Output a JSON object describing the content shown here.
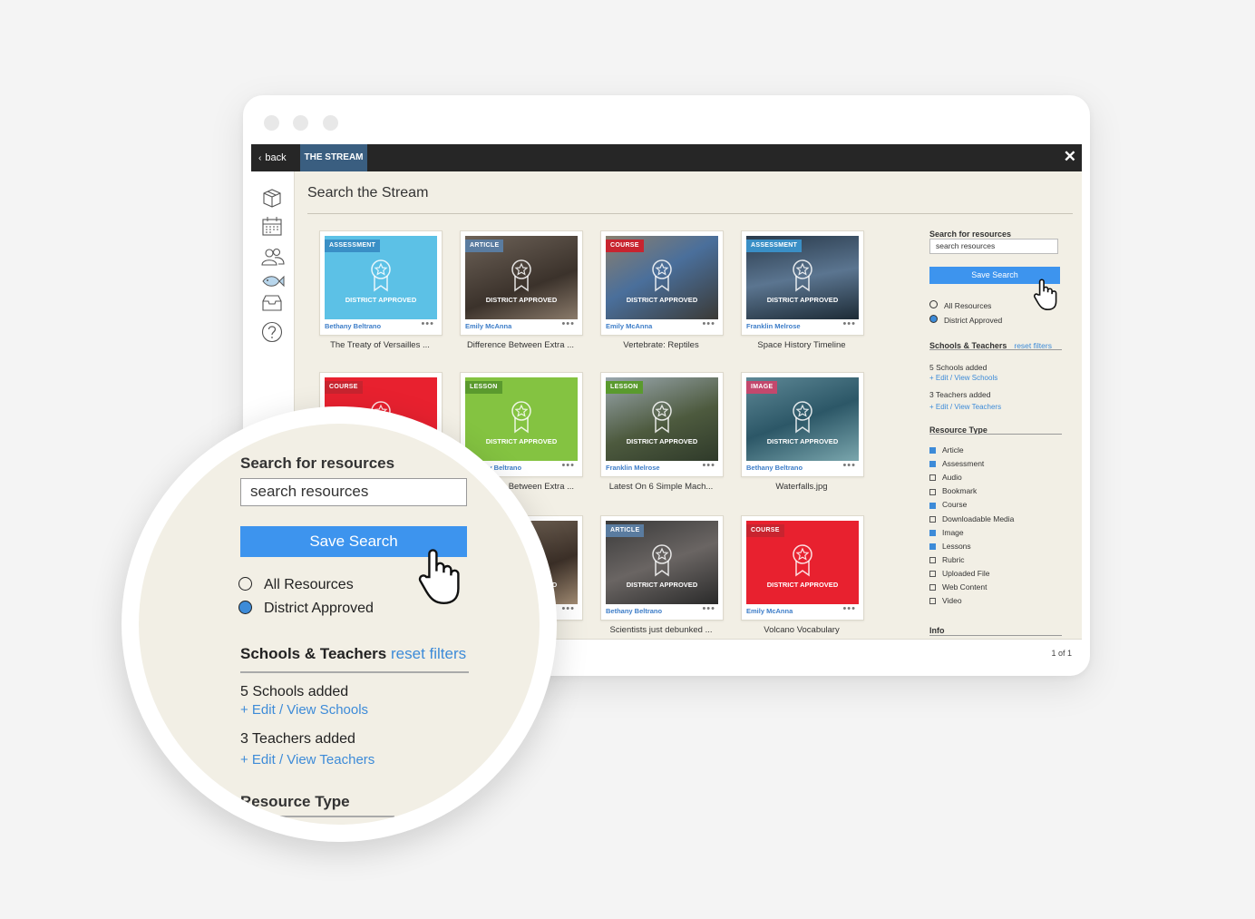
{
  "app": {
    "back_label": "back",
    "tab_label": "THE STREAM",
    "close_label": "✕",
    "page_title": "Search the Stream",
    "pagination": "1 of 1"
  },
  "cards": [
    {
      "badge": "ASSESSMENT",
      "badge_color": "#3a8fc6",
      "bg": "#5cc1e6",
      "author": "Bethany Beltrano",
      "title": "The Treaty of Versailles ..."
    },
    {
      "badge": "ARTICLE",
      "badge_color": "#5a7ca0",
      "bg": "linear-gradient(160deg,#6d6258,#3b322b 60%,#8a7a6a)",
      "author": "Emily McAnna",
      "title": "Difference Between Extra ..."
    },
    {
      "badge": "COURSE",
      "badge_color": "#c8242f",
      "bg": "linear-gradient(150deg,#8a7f6e,#4a6f9b 45%,#3b3a36)",
      "author": "Emily McAnna",
      "title": "Vertebrate: Reptiles"
    },
    {
      "badge": "ASSESSMENT",
      "badge_color": "#3a8fc6",
      "bg": "linear-gradient(170deg,#2a3b4c,#5b7590 50%,#1d2b36)",
      "author": "Franklin Melrose",
      "title": "Space History Timeline"
    },
    {
      "badge": "COURSE",
      "badge_color": "#c8242f",
      "bg": "#e8212f",
      "author": "",
      "title": ""
    },
    {
      "badge": "LESSON",
      "badge_color": "#5a9a2e",
      "bg": "#84c341",
      "author": "Bethany Beltrano",
      "title": "Difference Between Extra ..."
    },
    {
      "badge": "LESSON",
      "badge_color": "#5a9a2e",
      "bg": "linear-gradient(160deg,#9aa7ae,#4d5a3e 55%,#2f3a2a)",
      "author": "Franklin Melrose",
      "title": "Latest On 6 Simple Mach..."
    },
    {
      "badge": "IMAGE",
      "badge_color": "#c3486d",
      "bg": "linear-gradient(160deg,#5e8896,#2c5767 50%,#7aa6ad)",
      "author": "Bethany Beltrano",
      "title": "Waterfalls.jpg"
    },
    {
      "badge": "",
      "badge_color": "#5a7ca0",
      "bg": "linear-gradient(160deg,#7d6f60,#3c3028 60%,#a08a72)",
      "author": "",
      "title": ""
    },
    {
      "badge": "ARTICLE",
      "badge_color": "#5a7ca0",
      "bg": "linear-gradient(160deg,#3a3a3a,#6a6563 50%,#2a2a2a)",
      "author": "Bethany Beltrano",
      "title": "Scientists just debunked ..."
    },
    {
      "badge": "COURSE",
      "badge_color": "#c8242f",
      "bg": "#e8212f",
      "author": "Emily McAnna",
      "title": "Volcano Vocabulary"
    }
  ],
  "approved_label": "DISTRICT APPROVED",
  "more_label": "•••",
  "search": {
    "heading": "Search for resources",
    "placeholder": "search resources",
    "save_label": "Save Search",
    "radio_all": "All Resources",
    "radio_district": "District Approved"
  },
  "schools": {
    "heading": "Schools & Teachers",
    "reset": "reset filters",
    "schools_added": "5 Schools added",
    "edit_schools": "+ Edit / View Schools",
    "teachers_added": "3 Teachers added",
    "edit_teachers": "+ Edit / View Teachers"
  },
  "resource_type": {
    "heading": "Resource Type",
    "items": [
      {
        "label": "Article",
        "checked": true
      },
      {
        "label": "Assessment",
        "checked": true
      },
      {
        "label": "Audio",
        "checked": false
      },
      {
        "label": "Bookmark",
        "checked": false
      },
      {
        "label": "Course",
        "checked": true
      },
      {
        "label": "Downloadable Media",
        "checked": false
      },
      {
        "label": "Image",
        "checked": true
      },
      {
        "label": "Lessons",
        "checked": true
      },
      {
        "label": "Rubric",
        "checked": false
      },
      {
        "label": "Uploaded File",
        "checked": false
      },
      {
        "label": "Web Content",
        "checked": false
      },
      {
        "label": "Video",
        "checked": false
      }
    ]
  },
  "info_heading": "Info",
  "nav_icons": [
    "package-icon",
    "calendar-icon",
    "users-icon",
    "fish-icon",
    "inbox-icon",
    "help-icon"
  ]
}
